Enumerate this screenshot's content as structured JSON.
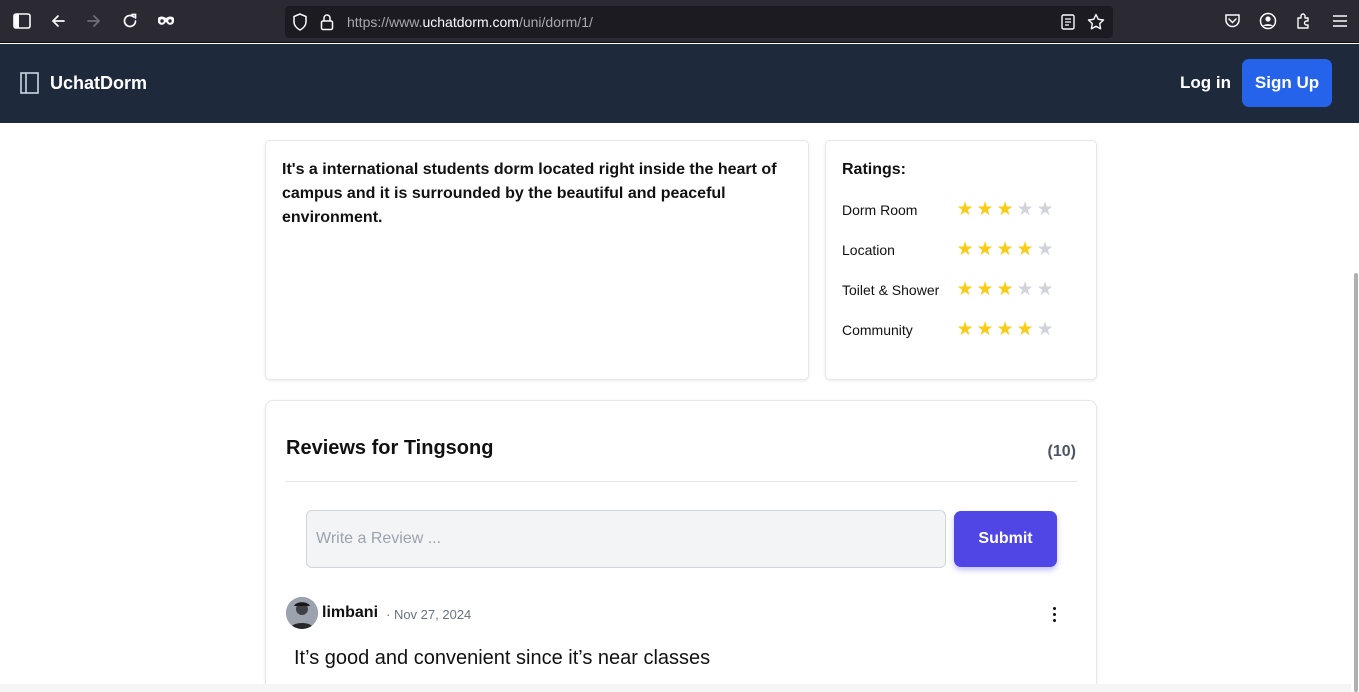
{
  "browser": {
    "url_prefix": "https://www.",
    "url_host": "uchatdorm.com",
    "url_path": "/uni/dorm/1/",
    "icons": [
      "sidebar-icon",
      "back-icon",
      "forward-icon",
      "reload-icon",
      "private-mask-icon",
      "shield-icon",
      "lock-icon",
      "reader-view-icon",
      "bookmark-star-icon",
      "pocket-icon",
      "account-icon",
      "extensions-icon",
      "menu-icon"
    ]
  },
  "navbar": {
    "brand": "UchatDorm",
    "login_label": "Log in",
    "signup_label": "Sign Up"
  },
  "description": {
    "text": "It's a international students dorm located right inside the heart of campus and it is surrounded by the beautiful and peaceful environment."
  },
  "ratings": {
    "title": "Ratings:",
    "items": [
      {
        "label": "Dorm Room",
        "stars": 3,
        "max": 5
      },
      {
        "label": "Location",
        "stars": 4,
        "max": 5
      },
      {
        "label": "Toilet & Shower",
        "stars": 3,
        "max": 5
      },
      {
        "label": "Community",
        "stars": 4,
        "max": 5
      }
    ]
  },
  "reviews": {
    "title": "Reviews for Tingsong",
    "count": "(10)",
    "input_placeholder": "Write a Review ...",
    "submit_label": "Submit",
    "list": [
      {
        "author": "limbani",
        "date": "· Nov 27, 2024",
        "text": "It’s good and convenient since it’s near classes"
      }
    ]
  },
  "colors": {
    "navbar_bg": "#1e293b",
    "signup_bg": "#2563eb",
    "submit_bg": "#4f46e5",
    "star_on": "#facc15",
    "star_off": "#d1d5db"
  }
}
